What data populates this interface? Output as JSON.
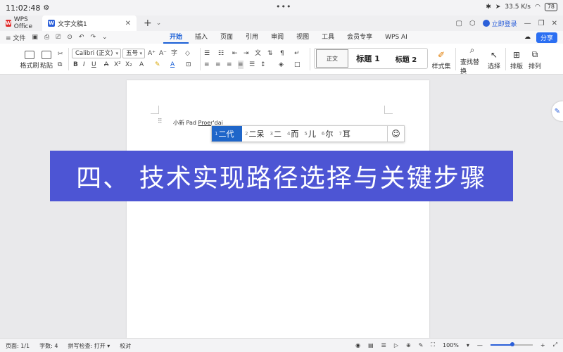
{
  "status": {
    "time": "11:02:48",
    "battery": "78",
    "signal": "33.5 K/s"
  },
  "tabs": {
    "wps": "WPS Office",
    "doc": "文字文稿1",
    "login": "立即登录"
  },
  "menu": {
    "file": "文件",
    "tabs": [
      "开始",
      "插入",
      "页面",
      "引用",
      "审阅",
      "视图",
      "工具",
      "会员专享",
      "WPS AI"
    ],
    "share": "分享"
  },
  "toolbar": {
    "format_painter": "格式刷",
    "paste": "粘贴",
    "font": "Calibri (正文)",
    "size": "五号",
    "styles": {
      "normal": "正文",
      "h1": "标题 1",
      "h2": "标题 2"
    },
    "style_set": "样式集",
    "find_replace": "查找替换",
    "select": "选择",
    "layout": "排版",
    "arrange": "排列"
  },
  "document": {
    "text_prefix": "小新 Pad ",
    "text_input": "Proer'dai"
  },
  "ime": {
    "candidates": [
      {
        "num": "1",
        "text": "二代"
      },
      {
        "num": "2",
        "text": "二呆"
      },
      {
        "num": "3",
        "text": "二"
      },
      {
        "num": "4",
        "text": "而"
      },
      {
        "num": "5",
        "text": "儿"
      },
      {
        "num": "6",
        "text": "尔"
      },
      {
        "num": "7",
        "text": "耳"
      }
    ],
    "emoji": "☺"
  },
  "banner": {
    "text": "四、 技术实现路径选择与关键步骤"
  },
  "footer": {
    "page": "页面: 1/1",
    "words": "字数: 4",
    "spell": "拼写检查: 打开",
    "proof": "校对",
    "zoom": "100%"
  }
}
